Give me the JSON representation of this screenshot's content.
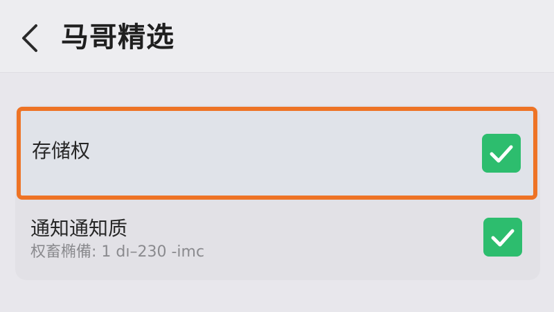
{
  "header": {
    "title": "马哥精选",
    "back_icon": "chevron-left-icon"
  },
  "settings": {
    "items": [
      {
        "label": "存储权",
        "checked": true,
        "highlighted": true
      },
      {
        "label": "通知通知质",
        "subtitle": "权畜椭備: 1 dı–230 -imc",
        "checked": true,
        "highlighted": false
      }
    ]
  },
  "colors": {
    "check_green": "#2dbd6e",
    "highlight_orange": "#ee7325",
    "background": "#e8e7ec"
  }
}
